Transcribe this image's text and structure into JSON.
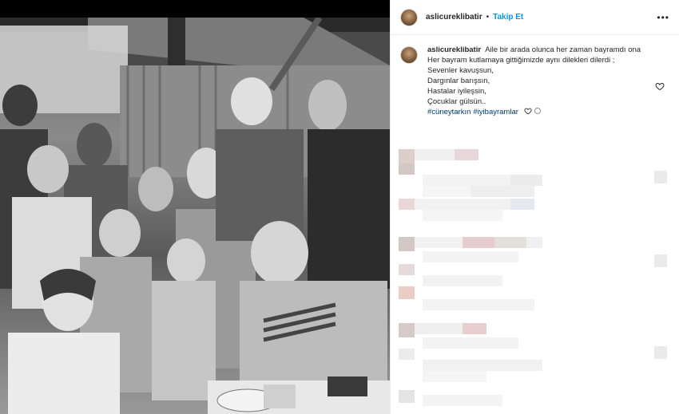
{
  "post": {
    "username": "aslicureklibatir",
    "separator": "•",
    "follow_label": "Takip Et",
    "more_label": "•••"
  },
  "caption": {
    "username": "aslicureklibatir",
    "lines": [
      "Aile bir arada olunca her zaman bayramdı ona",
      "Her bayram kutlamaya gittiğimizde aynı dilekleri dilerdi ;",
      "Sevenler kavuşsun,",
      "Dargınlar barışsın,",
      "Hastalar iyileşsin,",
      "Çocuklar gülsün.."
    ],
    "hashtags": [
      "#cüneytarkın",
      "#iyibayramlar"
    ]
  },
  "icons": {
    "heart": "heart-icon",
    "avatar": "profile-avatar",
    "emoji": "emoji-icon"
  },
  "colors": {
    "follow": "#0095f6",
    "hashtag": "#00376b",
    "text": "#262626",
    "border": "#efefef"
  }
}
